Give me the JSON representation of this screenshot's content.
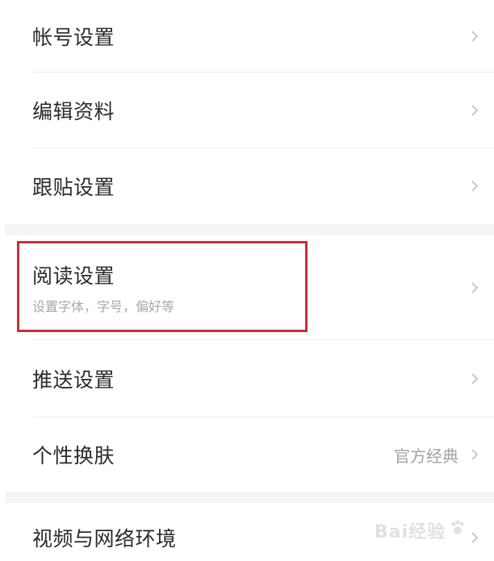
{
  "settings": {
    "group1": [
      {
        "label": "帐号设置"
      },
      {
        "label": "编辑资料"
      },
      {
        "label": "跟贴设置"
      }
    ],
    "reading": {
      "label": "阅读设置",
      "sub": "设置字体，字号，偏好等"
    },
    "push": {
      "label": "推送设置"
    },
    "skin": {
      "label": "个性换肤",
      "value": "官方经典"
    },
    "video": {
      "label": "视频与网络环境"
    }
  },
  "watermark": {
    "text": "Bai经验"
  },
  "icons": {
    "chevron": "chevron-right-icon"
  },
  "colors": {
    "highlight": "#c6303a",
    "divider": "#ececec",
    "section_gap": "#f5f5f5"
  }
}
